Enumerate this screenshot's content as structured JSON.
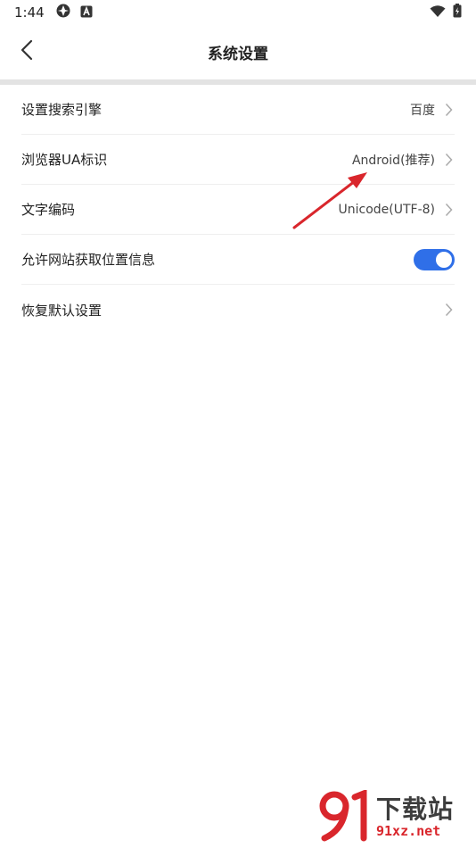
{
  "status_bar": {
    "time": "1:44"
  },
  "header": {
    "title": "系统设置",
    "back_icon": "chevron-left-icon"
  },
  "settings": {
    "search_engine": {
      "label": "设置搜索引擎",
      "value": "百度"
    },
    "browser_ua": {
      "label": "浏览器UA标识",
      "value": "Android(推荐)"
    },
    "text_encoding": {
      "label": "文字编码",
      "value": "Unicode(UTF-8)"
    },
    "location": {
      "label": "允许网站获取位置信息",
      "enabled": true
    },
    "restore": {
      "label": "恢复默认设置"
    }
  },
  "watermark": {
    "main": "下载站",
    "sub": "91xz.net"
  },
  "colors": {
    "accent": "#2f6fe8",
    "annotation": "#d9262c"
  }
}
